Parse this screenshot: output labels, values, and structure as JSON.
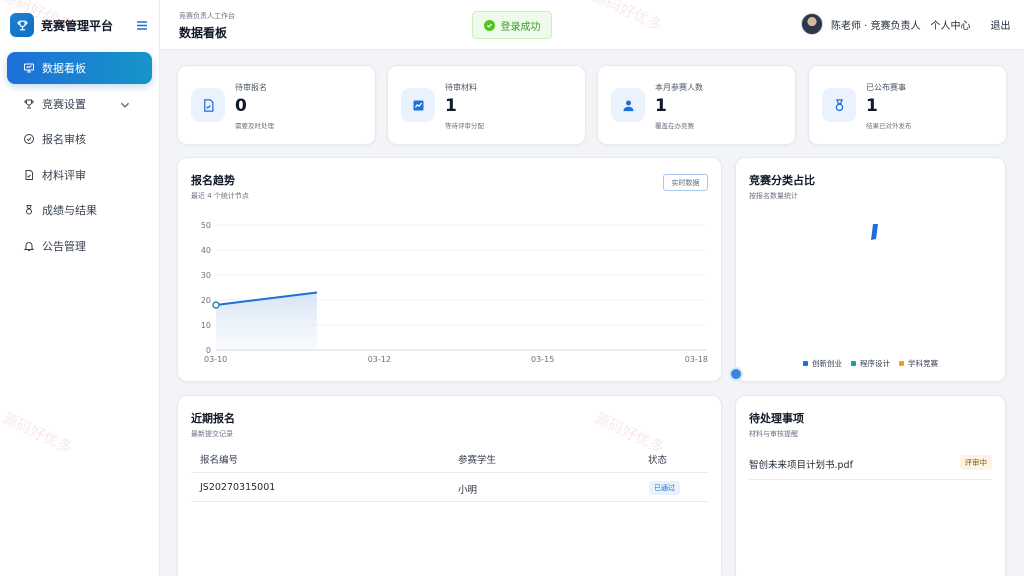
{
  "app": {
    "title": "竞赛管理平台"
  },
  "sidebar": {
    "items": [
      {
        "label": "数据看板",
        "icon": "monitor-icon",
        "active": true
      },
      {
        "label": "竞赛设置",
        "icon": "trophy-icon",
        "expandable": true
      },
      {
        "label": "报名审核",
        "icon": "check-circle-icon"
      },
      {
        "label": "材料评审",
        "icon": "document-check-icon"
      },
      {
        "label": "成绩与结果",
        "icon": "medal-icon"
      },
      {
        "label": "公告管理",
        "icon": "bell-icon"
      }
    ]
  },
  "header": {
    "subtitle": "竞赛负责人工作台",
    "title": "数据看板",
    "toast": "登录成功",
    "user": "陈老师 · 竞赛负责人",
    "profile_link": "个人中心",
    "logout": "退出"
  },
  "stats": [
    {
      "label": "待审报名",
      "value": "0",
      "note": "需要及时处理",
      "icon": "document-check-icon"
    },
    {
      "label": "待审材料",
      "value": "1",
      "note": "等待评审分配",
      "icon": "trend-chart-icon"
    },
    {
      "label": "本月参赛人数",
      "value": "1",
      "note": "覆盖在办竞赛",
      "icon": "user-icon"
    },
    {
      "label": "已公布赛事",
      "value": "1",
      "note": "结果已对外发布",
      "icon": "medal-icon"
    }
  ],
  "trend": {
    "title": "报名趋势",
    "subtitle": "最近 4 个统计节点",
    "badge": "实时数据"
  },
  "category": {
    "title": "竞赛分类占比",
    "subtitle": "按报名数量统计"
  },
  "chart_data": [
    {
      "type": "line",
      "x": [
        "03-10",
        "03-12",
        "03-15",
        "03-18"
      ],
      "series": [
        {
          "values": [
            18,
            23
          ]
        }
      ],
      "ylim": [
        0,
        50
      ],
      "yticks": [
        0,
        10,
        20,
        30,
        40,
        50
      ],
      "grid": true,
      "area_fill": true,
      "color": "#1e6fd9"
    },
    {
      "type": "pie",
      "categories": [
        "创新创业",
        "程序设计",
        "学科竞赛"
      ],
      "colors": [
        "#1e6fd9",
        "#14a39a",
        "#f59e0b"
      ],
      "legend": "bottom"
    }
  ],
  "recent": {
    "title": "近期报名",
    "subtitle": "最新提交记录",
    "columns": [
      "报名编号",
      "参赛学生",
      "状态"
    ],
    "rows": [
      {
        "id": "JS20270315001",
        "student": "小明",
        "status": "已通过"
      }
    ]
  },
  "pending": {
    "title": "待处理事项",
    "subtitle": "材料与审核提醒",
    "items": [
      {
        "name": "智创未来项目计划书.pdf",
        "status": "评审中"
      }
    ]
  },
  "watermark": "源码好优多",
  "colors": {
    "accent": "#1e6fd9",
    "success": "#52c41a",
    "warning": "#f59e0b"
  }
}
